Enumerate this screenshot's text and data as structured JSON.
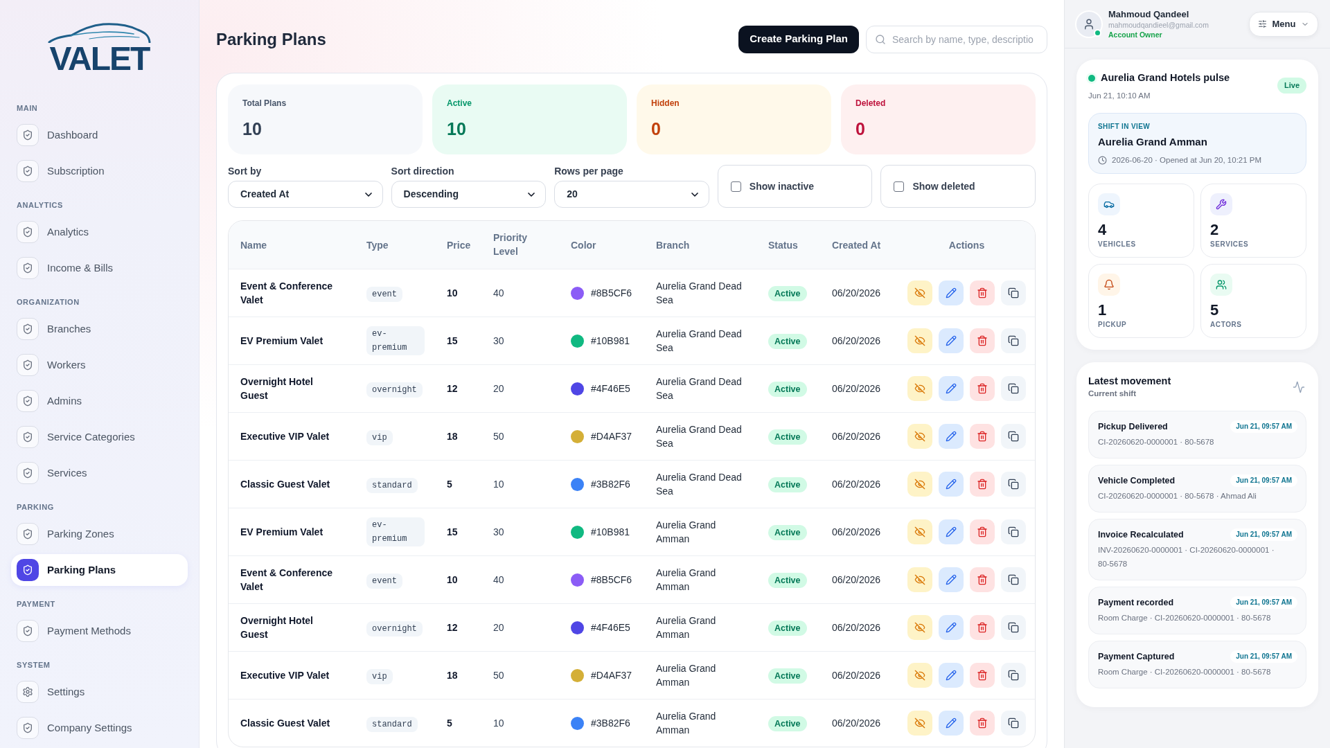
{
  "sidebar": {
    "logo": "VALET",
    "sections": [
      {
        "title": "MAIN",
        "items": [
          {
            "label": "Dashboard",
            "kind": "page",
            "selected": false
          },
          {
            "label": "Subscription",
            "kind": "page",
            "selected": false
          }
        ]
      },
      {
        "title": "ANALYTICS",
        "items": [
          {
            "label": "Analytics",
            "kind": "page",
            "selected": false
          },
          {
            "label": "Income & Bills",
            "kind": "page",
            "selected": false
          }
        ]
      },
      {
        "title": "ORGANIZATION",
        "items": [
          {
            "label": "Branches",
            "kind": "page",
            "selected": false
          },
          {
            "label": "Workers",
            "kind": "page",
            "selected": false
          },
          {
            "label": "Admins",
            "kind": "page",
            "selected": false
          },
          {
            "label": "Service Categories",
            "kind": "page",
            "selected": false
          },
          {
            "label": "Services",
            "kind": "page",
            "selected": false
          }
        ]
      },
      {
        "title": "PARKING",
        "items": [
          {
            "label": "Parking Zones",
            "kind": "page",
            "selected": false
          },
          {
            "label": "Parking Plans",
            "kind": "page",
            "selected": true
          }
        ]
      },
      {
        "title": "PAYMENT",
        "items": [
          {
            "label": "Payment Methods",
            "kind": "page",
            "selected": false
          }
        ]
      },
      {
        "title": "SYSTEM",
        "items": [
          {
            "label": "Settings",
            "kind": "settings",
            "selected": false
          },
          {
            "label": "Company Settings",
            "kind": "page",
            "selected": false
          }
        ]
      }
    ]
  },
  "header": {
    "title": "Parking Plans",
    "create_button": "Create Parking Plan",
    "search": {
      "placeholder": "Search by name, type, descriptio"
    }
  },
  "stats": [
    {
      "label": "Total Plans",
      "value": "10",
      "kind": "total"
    },
    {
      "label": "Active",
      "value": "10",
      "kind": "active"
    },
    {
      "label": "Hidden",
      "value": "0",
      "kind": "hidden"
    },
    {
      "label": "Deleted",
      "value": "0",
      "kind": "deleted"
    }
  ],
  "filters": {
    "selects": [
      {
        "label": "Sort by",
        "value": "Created At"
      },
      {
        "label": "Sort direction",
        "value": "Descending"
      },
      {
        "label": "Rows per page",
        "value": "20"
      }
    ],
    "checkboxes": [
      {
        "label": "Show inactive",
        "checked": false
      },
      {
        "label": "Show deleted",
        "checked": false
      }
    ]
  },
  "table": {
    "columns": [
      "Name",
      "Type",
      "Price",
      "Priority Level",
      "Color",
      "Branch",
      "Status",
      "Created At",
      "Actions"
    ],
    "rows": [
      {
        "name": "Event & Conference Valet",
        "type": "event",
        "price": "10",
        "priority": "40",
        "color": "#8b5cf6",
        "color_code": "#8B5CF6",
        "branch": "Aurelia Grand Dead Sea",
        "status": "Active",
        "created_at": "06/20/2026"
      },
      {
        "name": "EV Premium Valet",
        "type": "ev-premium",
        "price": "15",
        "priority": "30",
        "color": "#10b981",
        "color_code": "#10B981",
        "branch": "Aurelia Grand Dead Sea",
        "status": "Active",
        "created_at": "06/20/2026"
      },
      {
        "name": "Overnight Hotel Guest",
        "type": "overnight",
        "price": "12",
        "priority": "20",
        "color": "#4f46e5",
        "color_code": "#4F46E5",
        "branch": "Aurelia Grand Dead Sea",
        "status": "Active",
        "created_at": "06/20/2026"
      },
      {
        "name": "Executive VIP Valet",
        "type": "vip",
        "price": "18",
        "priority": "50",
        "color": "#d4af37",
        "color_code": "#D4AF37",
        "branch": "Aurelia Grand Dead Sea",
        "status": "Active",
        "created_at": "06/20/2026"
      },
      {
        "name": "Classic Guest Valet",
        "type": "standard",
        "price": "5",
        "priority": "10",
        "color": "#3b82f6",
        "color_code": "#3B82F6",
        "branch": "Aurelia Grand Dead Sea",
        "status": "Active",
        "created_at": "06/20/2026"
      },
      {
        "name": "EV Premium Valet",
        "type": "ev-premium",
        "price": "15",
        "priority": "30",
        "color": "#10b981",
        "color_code": "#10B981",
        "branch": "Aurelia Grand Amman",
        "status": "Active",
        "created_at": "06/20/2026"
      },
      {
        "name": "Event & Conference Valet",
        "type": "event",
        "price": "10",
        "priority": "40",
        "color": "#8b5cf6",
        "color_code": "#8B5CF6",
        "branch": "Aurelia Grand Amman",
        "status": "Active",
        "created_at": "06/20/2026"
      },
      {
        "name": "Overnight Hotel Guest",
        "type": "overnight",
        "price": "12",
        "priority": "20",
        "color": "#4f46e5",
        "color_code": "#4F46E5",
        "branch": "Aurelia Grand Amman",
        "status": "Active",
        "created_at": "06/20/2026"
      },
      {
        "name": "Executive VIP Valet",
        "type": "vip",
        "price": "18",
        "priority": "50",
        "color": "#d4af37",
        "color_code": "#D4AF37",
        "branch": "Aurelia Grand Amman",
        "status": "Active",
        "created_at": "06/20/2026"
      },
      {
        "name": "Classic Guest Valet",
        "type": "standard",
        "price": "5",
        "priority": "10",
        "color": "#3b82f6",
        "color_code": "#3B82F6",
        "branch": "Aurelia Grand Amman",
        "status": "Active",
        "created_at": "06/20/2026"
      }
    ]
  },
  "right_panel": {
    "user": {
      "name": "Mahmoud Qandeel",
      "email": "mahmoudqandieel@gmail.com",
      "role": "Account Owner",
      "online": true
    },
    "menu_button": "Menu",
    "pulse": {
      "title": "Aurelia Grand Hotels pulse",
      "time": "Jun 21, 10:10 AM",
      "badge": "Live",
      "shift": {
        "heading": "SHIFT IN VIEW",
        "name": "Aurelia Grand Amman",
        "details": "2026-06-20 · Opened at Jun 20, 10:21 PM"
      },
      "metrics": [
        {
          "value": "4",
          "label": "VEHICLES",
          "kind": "vehicles"
        },
        {
          "value": "2",
          "label": "SERVICES",
          "kind": "services"
        },
        {
          "value": "1",
          "label": "PICKUP",
          "kind": "pickup"
        },
        {
          "value": "5",
          "label": "ACTORS",
          "kind": "actors"
        }
      ]
    },
    "movement": {
      "title": "Latest movement",
      "subtitle": "Current shift",
      "items": [
        {
          "title": "Pickup Delivered",
          "time": "Jun 21, 09:57 AM",
          "details": "CI-20260620-0000001 · 80-5678"
        },
        {
          "title": "Vehicle Completed",
          "time": "Jun 21, 09:57 AM",
          "details": "CI-20260620-0000001 · 80-5678 · Ahmad Ali"
        },
        {
          "title": "Invoice Recalculated",
          "time": "Jun 21, 09:57 AM",
          "details": "INV-20260620-0000001 · CI-20260620-0000001 · 80-5678"
        },
        {
          "title": "Payment recorded",
          "time": "Jun 21, 09:57 AM",
          "details": "Room Charge · CI-20260620-0000001 · 80-5678"
        },
        {
          "title": "Payment Captured",
          "time": "Jun 21, 09:57 AM",
          "details": "Room Charge · CI-20260620-0000001 · 80-5678"
        }
      ]
    }
  }
}
